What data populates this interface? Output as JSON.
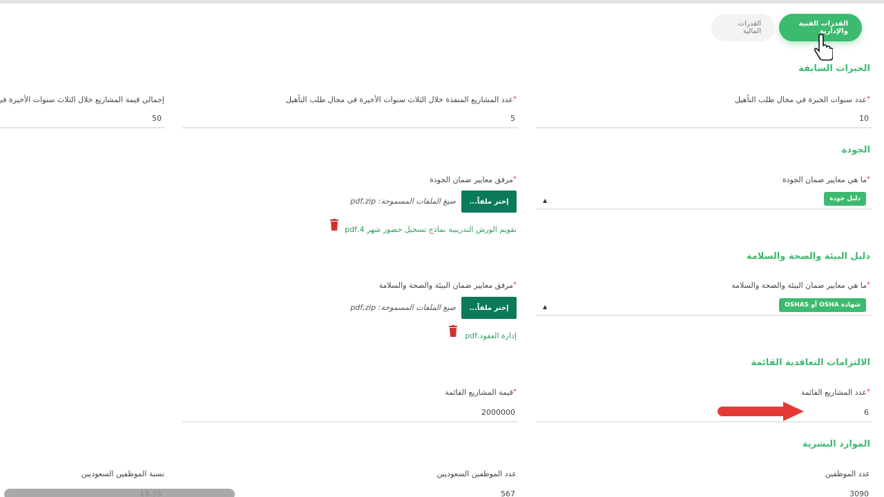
{
  "tabs": [
    {
      "label": "القدرات الفنية والإدارية",
      "active": true
    },
    {
      "label": "القدرات المالية",
      "active": false
    }
  ],
  "sections": {
    "experience": "الخبرات السابقة",
    "quality": "الجودة",
    "hse": "دليل البيئة والصحة والسلامة",
    "contracts": "الالتزامات التعاقدية القائمة",
    "hr": "الموارد البشرية"
  },
  "fields": {
    "years_experience": {
      "label": "عدد سنوات الخبرة في مجال طلب التأهيل",
      "value": "10"
    },
    "projects_count": {
      "label": "عدد المشاريع المنفذة خلال الثلاث سنوات الأخيرة في مجال طلب التأهيل",
      "value": "5"
    },
    "projects_total_value": {
      "label": "إجمالي قيمة المشاريع خلال الثلاث سنوات الأخيرة في",
      "value": "50"
    },
    "quality_standards": {
      "label": "ما هي معايير ضمان الجودة",
      "chip": "دليل جودة"
    },
    "quality_attachment": {
      "label": "مرفق معايير ضمان الجودة",
      "button": "إختر ملفاً...",
      "formats": "صيغ الملفات المسموحة: pdf,zip",
      "file": "تقويم الورش التدريبية نماذج تسجيل حضور شهر 4.pdf"
    },
    "hse_standards": {
      "label": "ما هي معايير ضمان البيئة والصحة والسلامة",
      "chip": "شهادة OSHA أو OSHAS"
    },
    "hse_attachment": {
      "label": "مرفق معايير ضمان البيئة والصحة والسلامة",
      "button": "إختر ملفاً...",
      "formats": "صيغ الملفات المسموحة: pdf,zip",
      "file": "إدارة العقود.pdf"
    },
    "current_projects_count": {
      "label": "عدد المشاريع القائمة",
      "value": "6"
    },
    "current_projects_value": {
      "label": "قيمة المشاريع القائمة",
      "value": "2000000"
    },
    "employees_count": {
      "label": "عدد الموظفين",
      "value": "3090"
    },
    "saudi_employees_count": {
      "label": "عدد الموظفين السعوديين",
      "value": "567"
    },
    "saudi_ratio": {
      "label": "نسبة الموظفين السعوديين",
      "value": "18.35"
    }
  },
  "colors": {
    "accent": "#3cba6f",
    "button": "#0b7a5a",
    "required": "#e53935",
    "arrow": "#e53935"
  }
}
